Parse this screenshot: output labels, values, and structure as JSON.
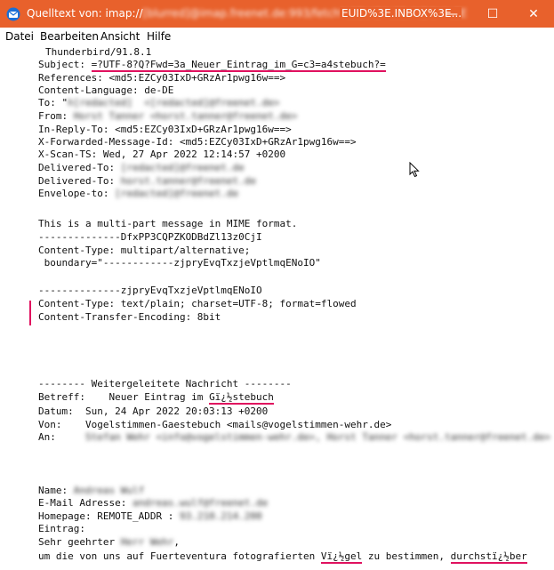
{
  "window": {
    "title_prefix": "Quelltext von: imap://",
    "title_blurred": "[blurred]@imap.freenet.de:993/fetch%3EUID%3E.INBOX%3E",
    "title_suffix": "EUID%3E.INBOX%3E...",
    "minimize": "—",
    "maximize": "☐",
    "close": "✕"
  },
  "menu": [
    {
      "label": "Datei"
    },
    {
      "label": "Bearbeiten"
    },
    {
      "label": "Ansicht"
    },
    {
      "label": "Hilfe"
    }
  ],
  "lines": {
    "l0": "Thunderbird/91.8.1",
    "l1a": "Subject: ",
    "l1b": "=?UTF-8?Q?Fwd=3a_Neuer_Eintrag_im_G=c3=a4stebuch?=",
    "l2": "References: <md5:EZCy03IxD+GRzAr1pwg16w==>",
    "l3": "Content-Language: de-DE",
    "l4a": "To: \"",
    "l4b": "h[redacted]  <[redacted]@freenet.de>",
    "l5a": "From: ",
    "l5b": "Horst Tanner <horst.tanner@freenet.de>",
    "l6": "In-Reply-To: <md5:EZCy03IxD+GRzAr1pwg16w==>",
    "l7": "X-Forwarded-Message-Id: <md5:EZCy03IxD+GRzAr1pwg16w==>",
    "l8": "X-Scan-TS: Wed, 27 Apr 2022 12:14:57 +0200",
    "l9a": "Delivered-To: ",
    "l9b": "[redacted]@freenet.de",
    "l10a": "Delivered-To: ",
    "l10b": "horst.tanner@freenet.de",
    "l11a": "Envelope-to: ",
    "l11b": "[redacted]@freenet.de",
    "l12": "This is a multi-part message in MIME format.",
    "l13": "--------------DfxPP3CQPZKODBdZl13z0CjI",
    "l14": "Content-Type: multipart/alternative;",
    "l15": " boundary=\"------------zjpryEvqTxzjeVptlmqENoIO\"",
    "l16": "--------------zjpryEvqTxzjeVptlmqENoIO",
    "l17": "Content-Type: text/plain; charset=UTF-8; format=flowed",
    "l18": "Content-Transfer-Encoding: 8bit",
    "l19": "-------- Weitergeleitete Nachricht --------",
    "l20a": "Betreff:    Neuer Eintrag im ",
    "l20b": "Gï¿½stebuch",
    "l21": "Datum:  Sun, 24 Apr 2022 20:03:13 +0200",
    "l22": "Von:    Vogelstimmen-Gaestebuch <mails@vogelstimmen-wehr.de>",
    "l23a": "An:     ",
    "l23b": "Stefan Wehr <info@vogelstimmen-wehr.de>, Horst Tanner <horst.tanner@freenet.de>",
    "l24a": "Name: ",
    "l24b": "Andreas Wulf",
    "l25a": "E-Mail Adresse: ",
    "l25b": "andreas.wulf@freenet.de",
    "l26a": "Homepage: REMOTE_ADDR : ",
    "l26b": "93.210.214.200",
    "l27": "Eintrag:",
    "l28a": "Sehr geehrter ",
    "l28b": "Herr Wehr",
    "l28c": ",",
    "l29a": "um die von uns auf Fuerteventura fotografierten ",
    "l29b": "Vï¿½gel",
    "l29c": " zu bestimmen, ",
    "l29d": "durchstï¿½ber"
  }
}
